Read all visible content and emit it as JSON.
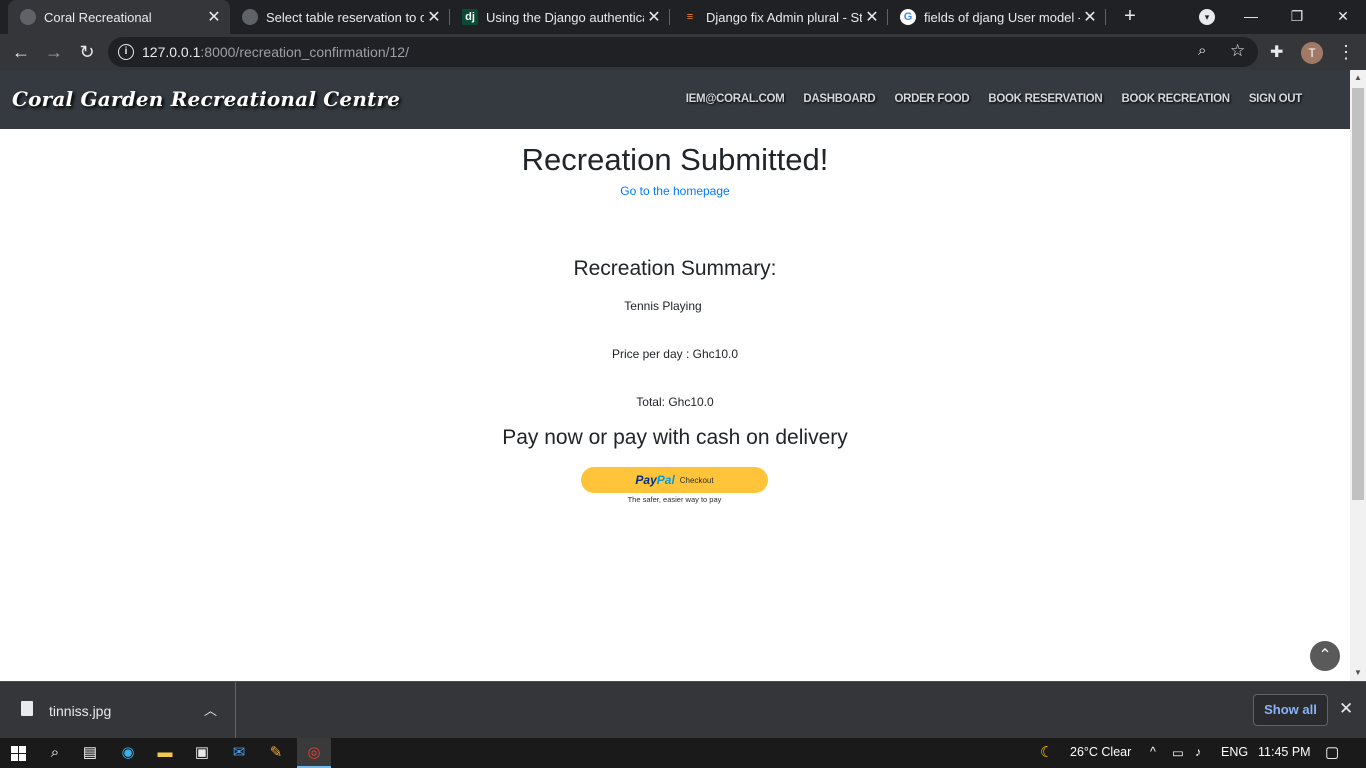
{
  "browser": {
    "tabs": [
      {
        "title": "Coral Recreational",
        "favicon": "globe-icon",
        "active": true
      },
      {
        "title": "Select table reservation to ch",
        "favicon": "globe-icon",
        "active": false
      },
      {
        "title": "Using the Django authenticat",
        "favicon": "django-icon",
        "favicon_text": "dj",
        "active": false
      },
      {
        "title": "Django fix Admin plural - Sta",
        "favicon": "stackoverflow-icon",
        "active": false
      },
      {
        "title": "fields of djang User model - G",
        "favicon": "google-icon",
        "favicon_text": "G",
        "active": false
      }
    ],
    "url_host": "127.0.0.1",
    "url_rest": ":8000/recreation_confirmation/12/",
    "profile_initial": "T"
  },
  "site": {
    "brand": "Coral Garden Recreational Centre",
    "nav": [
      "IEM@CORAL.COM",
      "DASHBOARD",
      "ORDER FOOD",
      "BOOK RESERVATION",
      "BOOK RECREATION",
      "SIGN OUT"
    ]
  },
  "confirmation": {
    "heading": "Recreation Submitted!",
    "home_link": "Go to the homepage",
    "summary_heading": "Recreation Summary:",
    "item": "Tennis Playing",
    "price_line": "Price per day : Ghc10.0",
    "total_line": "Total: Ghc10.0",
    "pay_heading": "Pay now or pay with cash on delivery",
    "paypal": {
      "logo_pay": "Pay",
      "logo_pal": "Pal",
      "button_text": "Checkout",
      "tagline": "The safer, easier way to pay",
      "color": "#ffc439"
    }
  },
  "downloads": {
    "file_name": "tinniss.jpg",
    "show_all": "Show all"
  },
  "taskbar": {
    "weather": "26°C  Clear",
    "language": "ENG",
    "time": "11:45 PM"
  },
  "colors": {
    "navbar_bg": "#343a40",
    "link": "#007bff",
    "browser_bg": "#202124"
  }
}
